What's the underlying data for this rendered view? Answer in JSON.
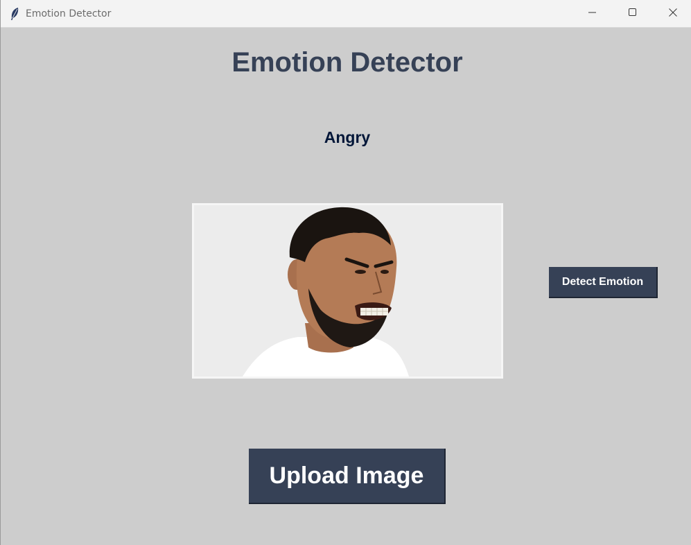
{
  "window": {
    "title": "Emotion Detector",
    "app_icon": "feather-icon",
    "controls": {
      "minimize_icon": "minimize-icon",
      "maximize_icon": "maximize-icon",
      "close_icon": "close-icon"
    }
  },
  "main": {
    "heading": "Emotion Detector",
    "result_label": "Angry",
    "image_alt": "photo of man with angry expression",
    "detect_button_label": "Detect Emotion",
    "upload_button_label": "Upload Image"
  },
  "colors": {
    "background": "#cdcdcd",
    "accent": "#364156",
    "result_text": "#011638",
    "button_text": "#ffffff"
  }
}
